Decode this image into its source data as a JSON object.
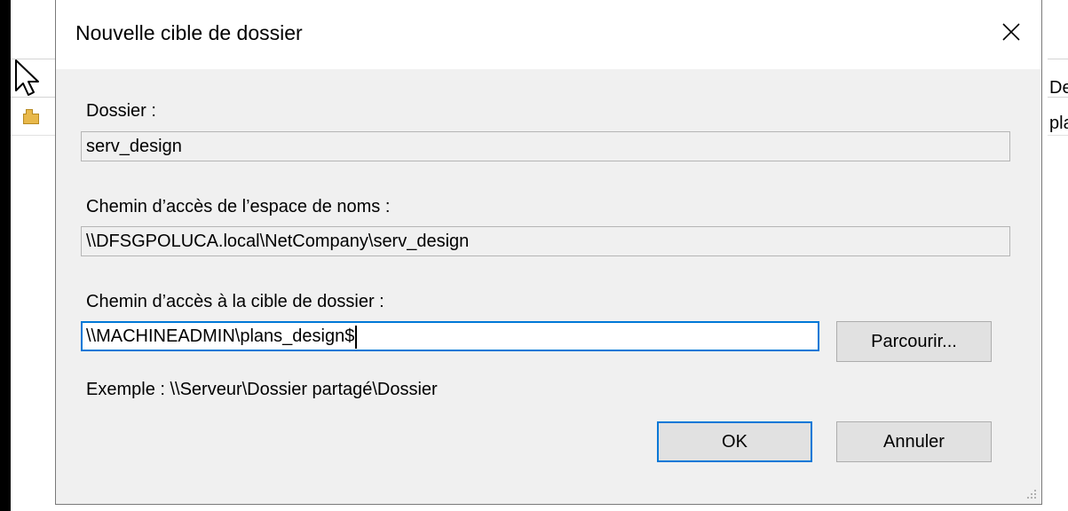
{
  "background": {
    "row_header_text_right": "De",
    "row1_text_right": "pla"
  },
  "dialog": {
    "title": "Nouvelle cible de dossier",
    "folder": {
      "label": "Dossier :",
      "value": "serv_design"
    },
    "namespace_path": {
      "label": "Chemin d’accès de l’espace de noms :",
      "value": "\\\\DFSGPOLUCA.local\\NetCompany\\serv_design"
    },
    "target_path": {
      "label": "Chemin d’accès à la cible de dossier :",
      "value": "\\\\MACHINEADMIN\\plans_design$"
    },
    "browse_label": "Parcourir...",
    "example": "Exemple : \\\\Serveur\\Dossier partagé\\Dossier",
    "ok_label": "OK",
    "cancel_label": "Annuler"
  },
  "icons": {
    "close": "close-icon",
    "cursor": "mouse-cursor-icon",
    "folder": "folder-icon",
    "resize": "resize-grip-icon"
  },
  "colors": {
    "accent": "#0078d7",
    "dialog_bg": "#f0f0f0",
    "button_bg": "#e1e1e1"
  }
}
